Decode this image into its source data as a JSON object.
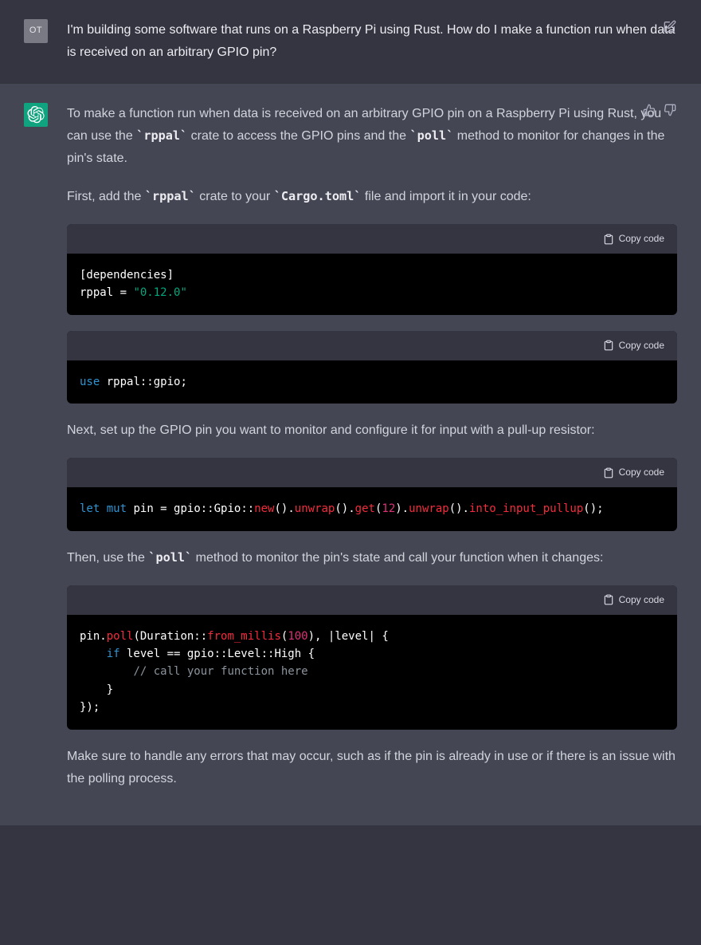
{
  "user": {
    "avatar_initials": "OT",
    "question": "I'm building some software that runs on a Raspberry Pi using Rust. How do I make a function run when data is received on an arbitrary GPIO pin?"
  },
  "assistant": {
    "p1_a": "To make a function run when data is received on an arbitrary GPIO pin on a Raspberry Pi using Rust, you can use the ",
    "p1_code1": "rppal",
    "p1_b": " crate to access the GPIO pins and the ",
    "p1_code2": "poll",
    "p1_c": " method to monitor for changes in the pin's state.",
    "p2_a": "First, add the ",
    "p2_code1": "rppal",
    "p2_b": " crate to your ",
    "p2_code2": "Cargo.toml",
    "p2_c": " file and import it in your code:",
    "p3": "Next, set up the GPIO pin you want to monitor and configure it for input with a pull-up resistor:",
    "p4_a": "Then, use the ",
    "p4_code1": "poll",
    "p4_b": " method to monitor the pin's state and call your function when it changes:",
    "p5": "Make sure to handle any errors that may occur, such as if the pin is already in use or if there is an issue with the polling process."
  },
  "copy_label": "Copy code",
  "code1": {
    "l1_a": "[dependencies]",
    "l2_a": "rppal = ",
    "l2_b": "\"0.12.0\""
  },
  "code2": {
    "l1_a": "use",
    "l1_b": " rppal::gpio;"
  },
  "code3": {
    "l1_a": "let",
    "l1_b": " ",
    "l1_c": "mut",
    "l1_d": " pin = gpio::Gpio::",
    "l1_e": "new",
    "l1_f": "().",
    "l1_g": "unwrap",
    "l1_h": "().",
    "l1_i": "get",
    "l1_j": "(",
    "l1_k": "12",
    "l1_l": ").",
    "l1_m": "unwrap",
    "l1_n": "().",
    "l1_o": "into_input_pullup",
    "l1_p": "();"
  },
  "code4": {
    "l1_a": "pin.",
    "l1_b": "poll",
    "l1_c": "(Duration::",
    "l1_d": "from_millis",
    "l1_e": "(",
    "l1_f": "100",
    "l1_g": "), |level| {",
    "l2_a": "    ",
    "l2_b": "if",
    "l2_c": " level == gpio::Level::High {",
    "l3_a": "        ",
    "l3_b": "// call your function here",
    "l4_a": "    }",
    "l5_a": "});"
  }
}
